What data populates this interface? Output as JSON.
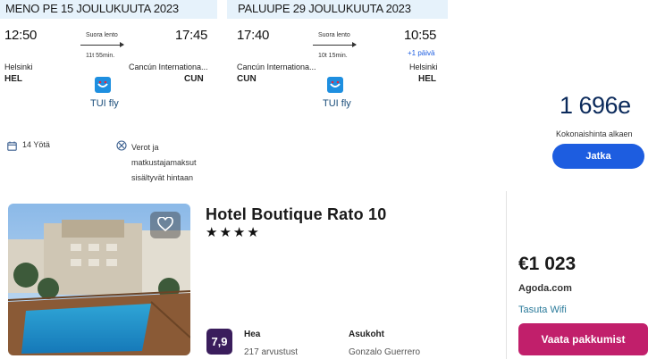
{
  "outbound": {
    "header": "MENO PE 15 JOULUKUUTA 2023",
    "dep_time": "12:50",
    "arr_time": "17:45",
    "stop_label": "Suora lento",
    "duration": "11t 55min.",
    "dep_city": "Helsinki",
    "dep_code": "HEL",
    "arr_city": "Cancún Internationa...",
    "arr_code": "CUN",
    "airline": "TUI fly"
  },
  "return": {
    "header": "PALUUPE 29 JOULUKUUTA 2023",
    "dep_time": "17:40",
    "arr_time": "10:55",
    "stop_label": "Suora lento",
    "duration": "10t 15min.",
    "next_day": "+1 päivä",
    "dep_city": "Cancún Internationa...",
    "dep_code": "CUN",
    "arr_city": "Helsinki",
    "arr_code": "HEL",
    "airline": "TUI fly"
  },
  "trip_info": {
    "nights": "14 Yötä",
    "taxes_line1": "Verot ja",
    "taxes_line2": "matkustajamaksut",
    "taxes_line3": "sisältyvät hintaan"
  },
  "package": {
    "price": "1 696e",
    "price_note": "Kokonaishinta alkaen",
    "continue_label": "Jatka"
  },
  "hotel": {
    "name": "Hotel Boutique Rato 10",
    "stars": "★★★★",
    "rating_score": "7,9",
    "rating_word": "Hea",
    "review_count": "217 arvustust",
    "location_label": "Asukoht",
    "location_value": "Gonzalo Guerrero",
    "price": "€1 023",
    "provider": "Agoda.com",
    "wifi": "Tasuta Wifi",
    "view_deals": "Vaata pakkumist"
  },
  "colors": {
    "header_bg": "#e6f2fb",
    "primary_blue": "#1d5de0",
    "view_deals_bg": "#c11f6b",
    "rating_badge_bg": "#3a1d5c"
  },
  "icons": [
    "calendar-icon",
    "no-tax-icon",
    "airline-logo-icon",
    "heart-icon"
  ]
}
